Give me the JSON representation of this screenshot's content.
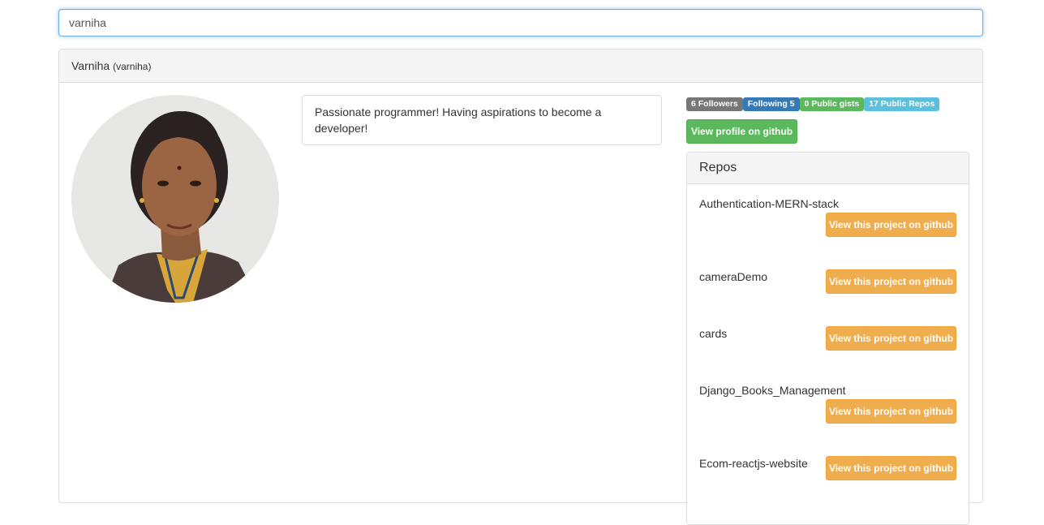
{
  "search": {
    "value": "varniha"
  },
  "profile": {
    "name": "Varniha",
    "login": "(varniha)",
    "bio": "Passionate programmer! Having aspirations to become a developer!",
    "badges": [
      {
        "label": "6 Followers",
        "color": "#777777"
      },
      {
        "label": "Following 5",
        "color": "#337ab7"
      },
      {
        "label": "0 Public gists",
        "color": "#5cb85c"
      },
      {
        "label": "17 Public Repos",
        "color": "#5bc0de"
      }
    ],
    "view_profile_label": "View profile on github"
  },
  "repos": {
    "title": "Repos",
    "button_label": "View this project on github",
    "items": [
      {
        "name": "Authentication-MERN-stack"
      },
      {
        "name": "cameraDemo"
      },
      {
        "name": "cards"
      },
      {
        "name": "Django_Books_Management"
      },
      {
        "name": "Ecom-reactjs-website"
      }
    ]
  }
}
